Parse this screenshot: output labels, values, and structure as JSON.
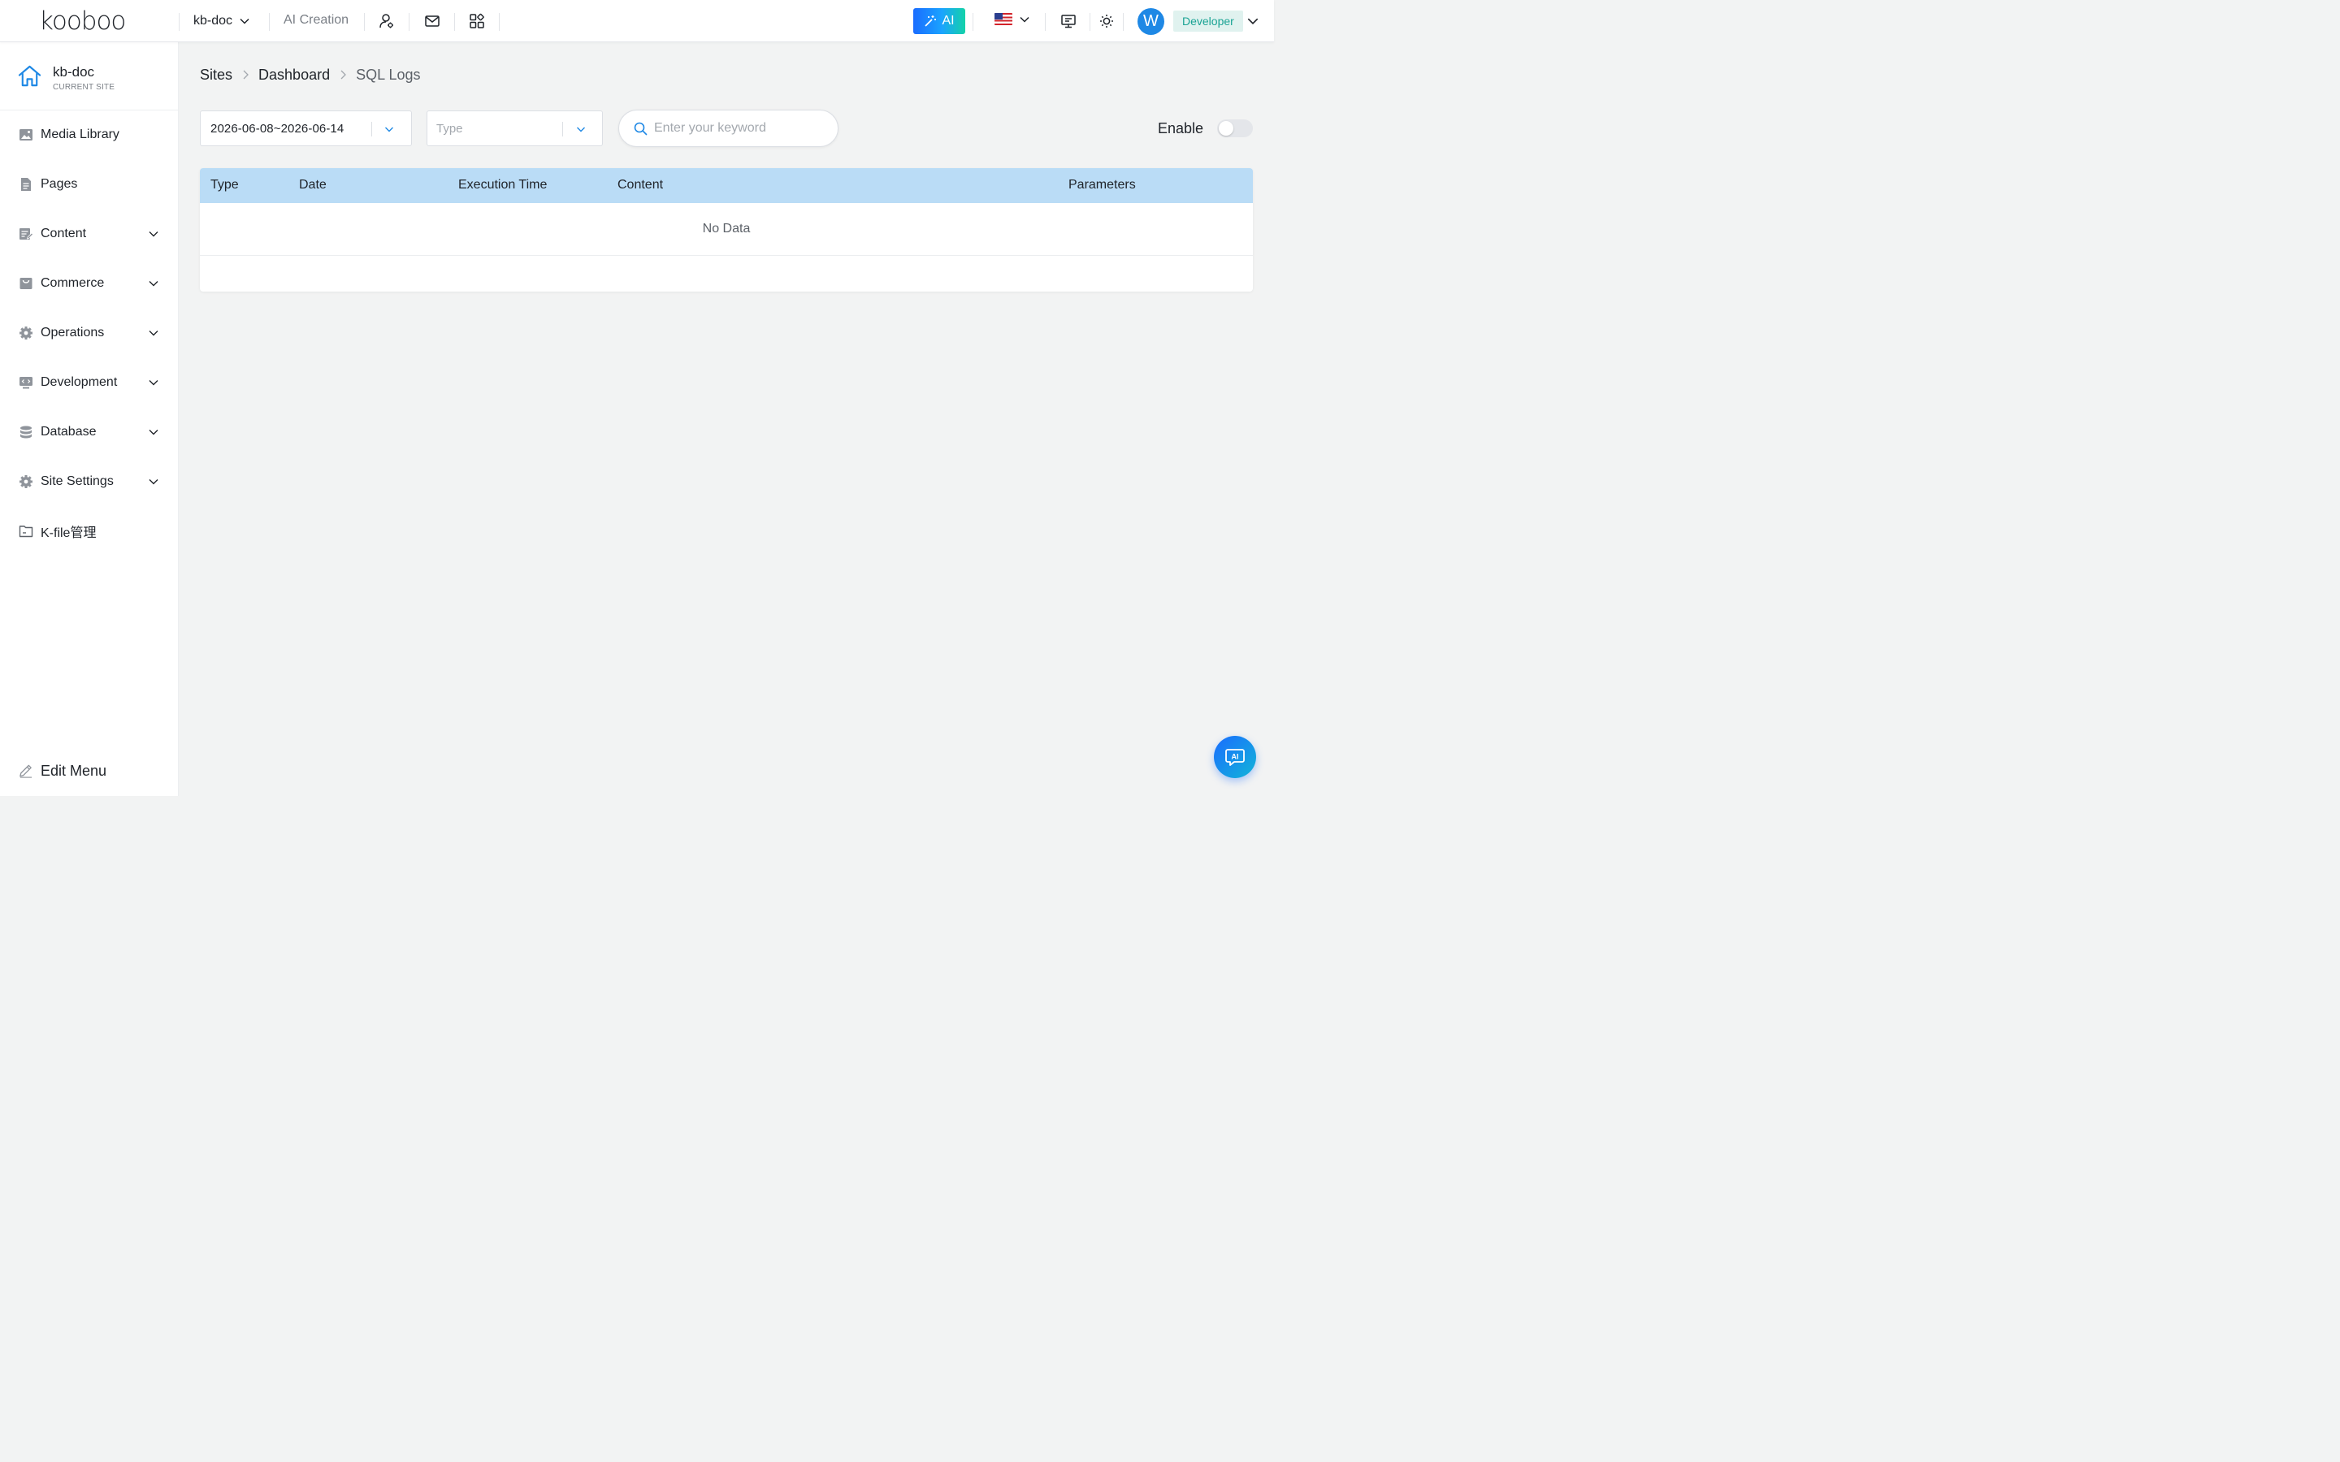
{
  "header": {
    "logo_text": "kooboo",
    "site_selector": "kb-doc",
    "ai_creation": "AI Creation",
    "ai_button": "AI",
    "avatar_initial": "W",
    "role": "Developer"
  },
  "sidebar": {
    "current_site_name": "kb-doc",
    "current_site_caption": "CURRENT SITE",
    "items": [
      {
        "label": "Media Library",
        "icon": "image-icon",
        "expandable": false
      },
      {
        "label": "Pages",
        "icon": "document-icon",
        "expandable": false
      },
      {
        "label": "Content",
        "icon": "edit-document-icon",
        "expandable": true
      },
      {
        "label": "Commerce",
        "icon": "shopping-bag-icon",
        "expandable": true
      },
      {
        "label": "Operations",
        "icon": "gear-icon",
        "expandable": true
      },
      {
        "label": "Development",
        "icon": "code-icon",
        "expandable": true
      },
      {
        "label": "Database",
        "icon": "database-icon",
        "expandable": true
      },
      {
        "label": "Site Settings",
        "icon": "gear-icon",
        "expandable": true
      },
      {
        "label": "K-file管理",
        "icon": "folder-icon",
        "expandable": false
      }
    ],
    "edit_menu": "Edit Menu"
  },
  "breadcrumb": {
    "items": [
      "Sites",
      "Dashboard",
      "SQL Logs"
    ]
  },
  "filters": {
    "date_range": "2026-06-08~2026-06-14",
    "type_placeholder": "Type",
    "search_placeholder": "Enter your keyword",
    "enable_label": "Enable",
    "enable_on": false
  },
  "table": {
    "columns": [
      "Type",
      "Date",
      "Execution Time",
      "Content",
      "Parameters"
    ],
    "rows": [],
    "empty_text": "No Data"
  },
  "colors": {
    "accent": "#1e88e5",
    "table_header": "#badcf6",
    "role_badge_bg": "#e0f2ef",
    "role_badge_text": "#1aa394"
  }
}
